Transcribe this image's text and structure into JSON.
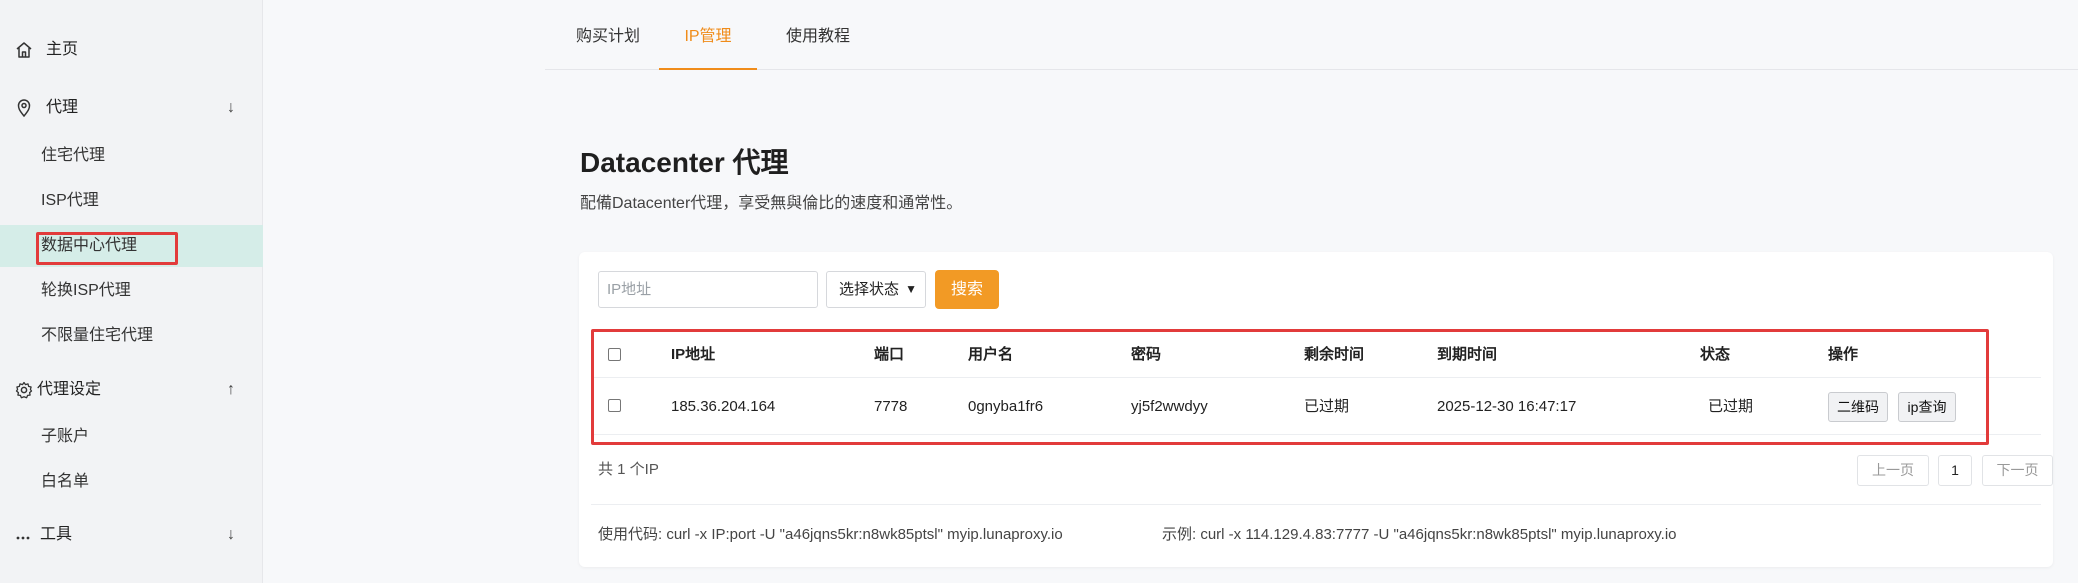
{
  "sidebar": {
    "home_label": "主页",
    "proxy_label": "代理",
    "proxy_items": [
      "住宅代理",
      "ISP代理",
      "数据中心代理",
      "轮换ISP代理",
      "不限量住宅代理"
    ],
    "settings_label": "代理设定",
    "settings_items": [
      "子账户",
      "白名单"
    ],
    "tools_label": "工具",
    "down_arrow": "↓",
    "up_arrow": "↑"
  },
  "tabs": [
    "购买计划",
    "IP管理",
    "使用教程"
  ],
  "active_tab": "IP管理",
  "page": {
    "title": "Datacenter 代理",
    "subtitle": "配備Datacenter代理，享受無與倫比的速度和通常性。"
  },
  "filters": {
    "ip_placeholder": "IP地址",
    "status_select": "选择状态",
    "search_button": "搜索"
  },
  "table": {
    "columns": [
      "IP地址",
      "端口",
      "用户名",
      "密码",
      "剩余时间",
      "到期时间",
      "状态",
      "操作"
    ],
    "rows": [
      {
        "ip": "185.36.204.164",
        "port": "7778",
        "username": "0gnyba1fr6",
        "password": "yj5f2wwdyy",
        "remaining": "已过期",
        "expires": "2025-12-30 16:47:17",
        "status": "已过期",
        "actions": [
          "二维码",
          "ip查询"
        ]
      }
    ]
  },
  "footer": {
    "count": "共 1 个IP",
    "prev": "上一页",
    "page": "1",
    "next": "下一页",
    "usage": "使用代码: curl -x IP:port -U \"a46jqns5kr:n8wk85ptsl\" myip.lunaproxy.io",
    "example": "示例: curl -x 114.129.4.83:7777 -U \"a46jqns5kr:n8wk85ptsl\" myip.lunaproxy.io"
  },
  "colors": {
    "accent": "#f08c1a",
    "button": "#f29a25",
    "highlight": "#e23b3b",
    "active_nav": "#d5ede8"
  }
}
